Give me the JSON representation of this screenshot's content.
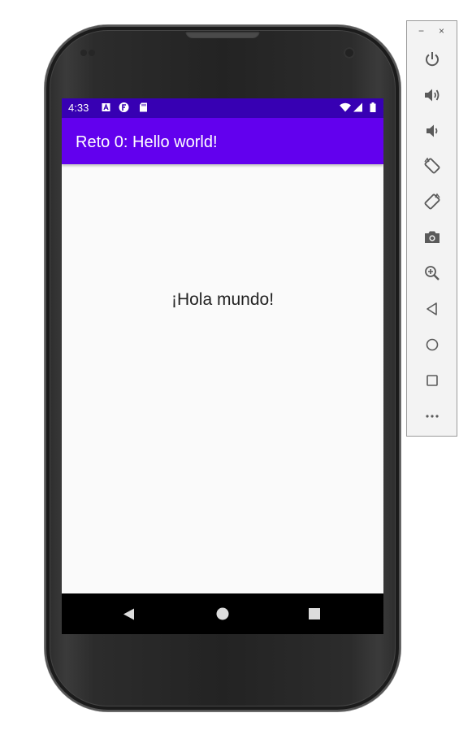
{
  "status_bar": {
    "time": "4:33",
    "icons": [
      "notification-a-icon",
      "notification-f-icon",
      "sd-card-icon",
      "wifi-icon",
      "signal-icon",
      "battery-icon"
    ]
  },
  "app_bar": {
    "title": "Reto 0: Hello world!"
  },
  "content": {
    "text": "¡Hola mundo!"
  },
  "nav_bar": {
    "buttons": [
      "back-icon",
      "home-icon",
      "recents-icon"
    ]
  },
  "emulator_toolbar": {
    "window_controls": {
      "minimize": "−",
      "close": "×"
    },
    "tools": [
      "power",
      "volume-up",
      "volume-down",
      "rotate-left",
      "rotate-right",
      "screenshot",
      "zoom",
      "back",
      "home",
      "overview",
      "more"
    ]
  },
  "colors": {
    "status_bar": "#3700b3",
    "app_bar": "#6200ee",
    "screen_bg": "#fafafa",
    "nav_bar": "#000000",
    "icon": "#5a5a5a"
  }
}
